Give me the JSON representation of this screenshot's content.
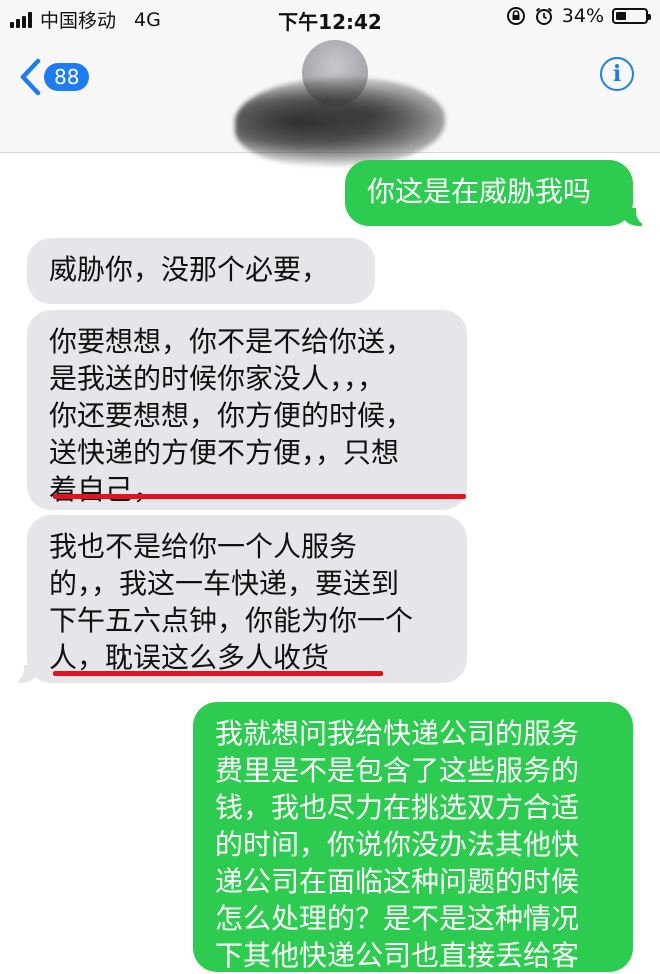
{
  "status_bar": {
    "carrier": "中国移动",
    "network": "4G",
    "time": "下午12:42",
    "battery_percent": "34%",
    "battery_level": 0.34
  },
  "header": {
    "back_count": "88",
    "info_label": "i"
  },
  "messages": [
    {
      "direction": "outgoing",
      "lines": [
        "你这是在威胁我吗"
      ]
    },
    {
      "direction": "incoming",
      "lines": [
        "威胁你，没那个必要，"
      ]
    },
    {
      "direction": "incoming",
      "lines": [
        "你要想想，你不是不给你送，",
        "是我送的时候你家没人，，，",
        "你还要想想，你方便的时候，",
        "送快递的方便不方便，，只想",
        "着自己，"
      ]
    },
    {
      "direction": "incoming",
      "lines": [
        "我也不是给你一个人服务",
        "的，，我这一车快递，要送到",
        "下午五六点钟，你能为你一个",
        "人，耽误这么多人收货"
      ]
    },
    {
      "direction": "outgoing",
      "lines": [
        "我就想问我给快递公司的服务",
        "费里是不是包含了这些服务的",
        "钱，我也尽力在挑选双方合适",
        "的时间，你说你没办法其他快",
        "递公司在面临这种问题的时候",
        "怎么处理的？是不是这种情况",
        "下其他快递公司也直接丢给客"
      ]
    }
  ],
  "colors": {
    "outgoing_bubble": "#2dcc50",
    "incoming_bubble": "#e5e5ea",
    "accent": "#1e7cf0",
    "underline": "#e0141e"
  }
}
